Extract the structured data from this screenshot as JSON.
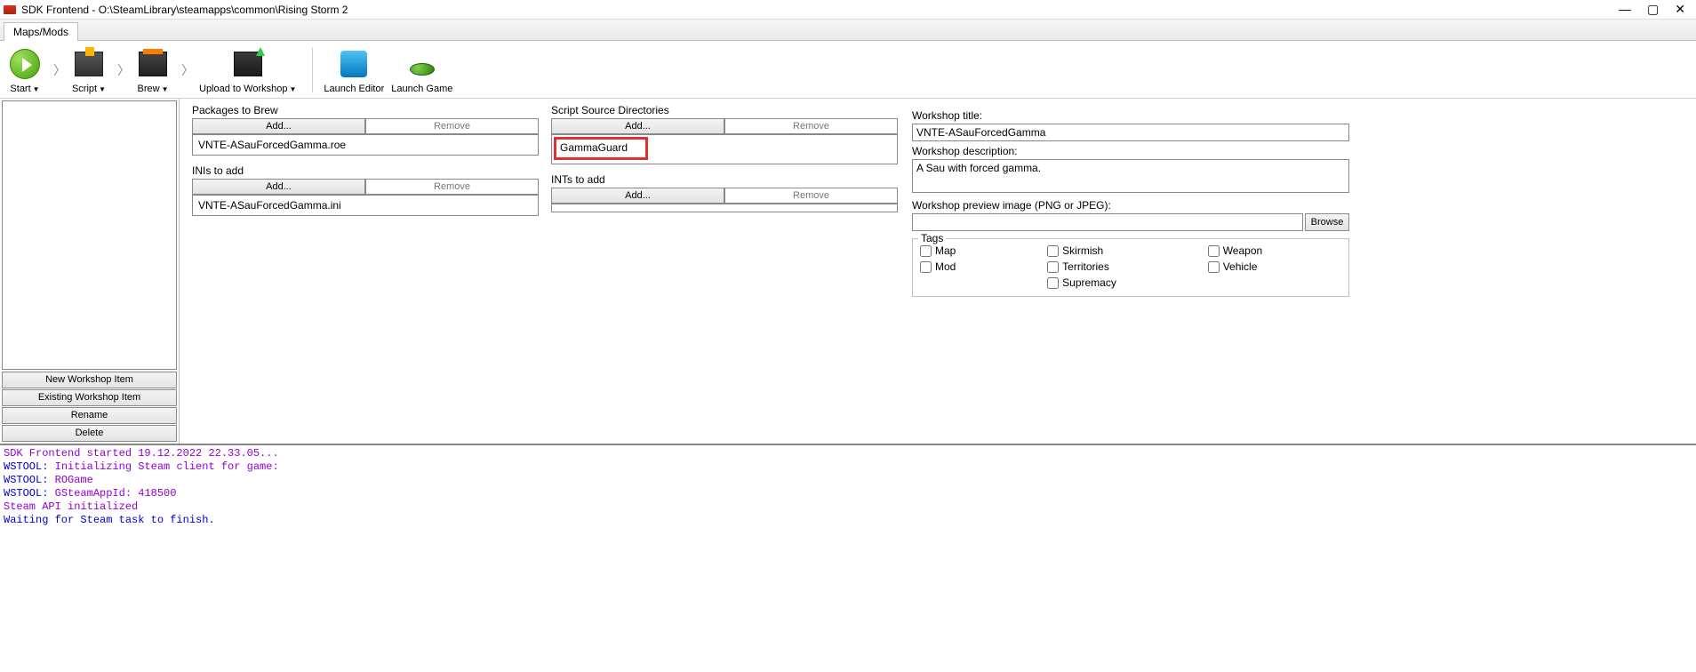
{
  "window": {
    "title": "SDK Frontend - O:\\SteamLibrary\\steamapps\\common\\Rising Storm 2"
  },
  "tabs": {
    "main": "Maps/Mods"
  },
  "toolbar": {
    "start": "Start",
    "script": "Script",
    "brew": "Brew",
    "upload": "Upload to Workshop",
    "editor": "Launch Editor",
    "game": "Launch Game"
  },
  "leftButtons": {
    "new": "New Workshop Item",
    "existing": "Existing Workshop Item",
    "rename": "Rename",
    "delete": "Delete"
  },
  "panels": {
    "packages": {
      "title": "Packages to Brew",
      "add": "Add...",
      "remove": "Remove",
      "items": [
        "VNTE-ASauForcedGamma.roe"
      ]
    },
    "scripts": {
      "title": "Script Source Directories",
      "add": "Add...",
      "remove": "Remove",
      "items": [
        "GammaGuard"
      ]
    },
    "inis": {
      "title": "INIs to add",
      "add": "Add...",
      "remove": "Remove",
      "items": [
        "VNTE-ASauForcedGamma.ini"
      ]
    },
    "ints": {
      "title": "INTs to add",
      "add": "Add...",
      "remove": "Remove",
      "items": []
    }
  },
  "workshop": {
    "titleLabel": "Workshop title:",
    "titleValue": "VNTE-ASauForcedGamma",
    "descLabel": "Workshop description:",
    "descValue": "A Sau with forced gamma.",
    "previewLabel": "Workshop preview image (PNG or JPEG):",
    "previewValue": "",
    "browse": "Browse",
    "tagsLabel": "Tags",
    "tags": {
      "map": "Map",
      "skirmish": "Skirmish",
      "weapon": "Weapon",
      "mod": "Mod",
      "territories": "Territories",
      "vehicle": "Vehicle",
      "supremacy": "Supremacy"
    }
  },
  "console": {
    "l1": "SDK Frontend started 19.12.2022 22.33.05...",
    "l2a": "WSTOOL:",
    "l2b": "    Initializing Steam client for game:",
    "l3a": "WSTOOL:",
    "l3b": "    ROGame",
    "l4a": "WSTOOL:",
    "l4b": "    GSteamAppId: 418500",
    "l5": "Steam API initialized",
    "l6": "Waiting for Steam task to finish."
  }
}
